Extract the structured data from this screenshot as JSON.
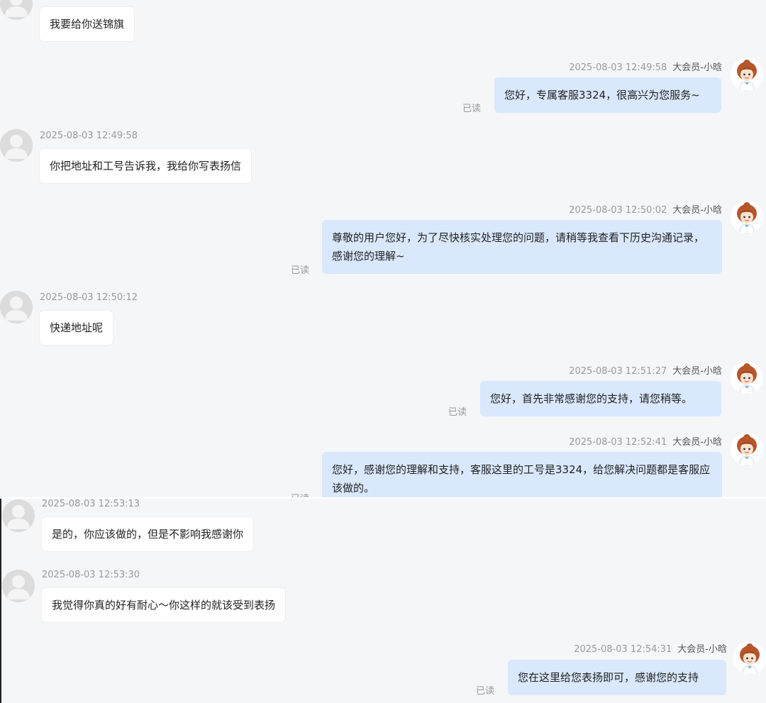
{
  "messages": [
    {
      "side": "user",
      "time": "",
      "text": "我要给你送锦旗"
    },
    {
      "side": "agent",
      "time": "2025-08-03 12:49:58",
      "sender": "大会员-小晗",
      "text": "您好，专属客服3324，很高兴为您服务~",
      "status": "已读"
    },
    {
      "side": "user",
      "time": "2025-08-03 12:49:58",
      "text": "你把地址和工号告诉我，我给你写表扬信"
    },
    {
      "side": "agent",
      "time": "2025-08-03 12:50:02",
      "sender": "大会员-小晗",
      "text": "尊敬的用户您好，为了尽快核实处理您的问题，请稍等我查看下历史沟通记录，感谢您的理解~",
      "status": "已读"
    },
    {
      "side": "user",
      "time": "2025-08-03 12:50:12",
      "text": "快递地址呢"
    },
    {
      "side": "agent",
      "time": "2025-08-03 12:51:27",
      "sender": "大会员-小晗",
      "text": "您好，首先非常感谢您的支持，请您稍等。",
      "status": "已读"
    },
    {
      "side": "agent",
      "time": "2025-08-03 12:52:41",
      "sender": "大会员-小晗",
      "text": "您好，感谢您的理解和支持，客服这里的工号是3324，给您解决问题都是客服应该做的。",
      "status": "已读"
    },
    {
      "side": "user",
      "time": "2025-08-03 12:53:13",
      "text": "是的，你应该做的，但是不影响我感谢你"
    },
    {
      "side": "user",
      "time": "2025-08-03 12:53:30",
      "text": "我觉得你真的好有耐心～你这样的就该受到表扬"
    },
    {
      "side": "agent",
      "time": "2025-08-03 12:54:31",
      "sender": "大会员-小晗",
      "text": "您在这里给您表扬即可，感谢您的支持",
      "status": "已读"
    }
  ],
  "icons": {
    "user_avatar": "person-silhouette-icon",
    "agent_avatar": "cartoon-agent-avatar-icon"
  },
  "colors": {
    "background": "#f5f6f8",
    "agent_bubble": "#d9e8fd",
    "user_bubble": "#ffffff",
    "muted_text": "#9a9a9a"
  }
}
